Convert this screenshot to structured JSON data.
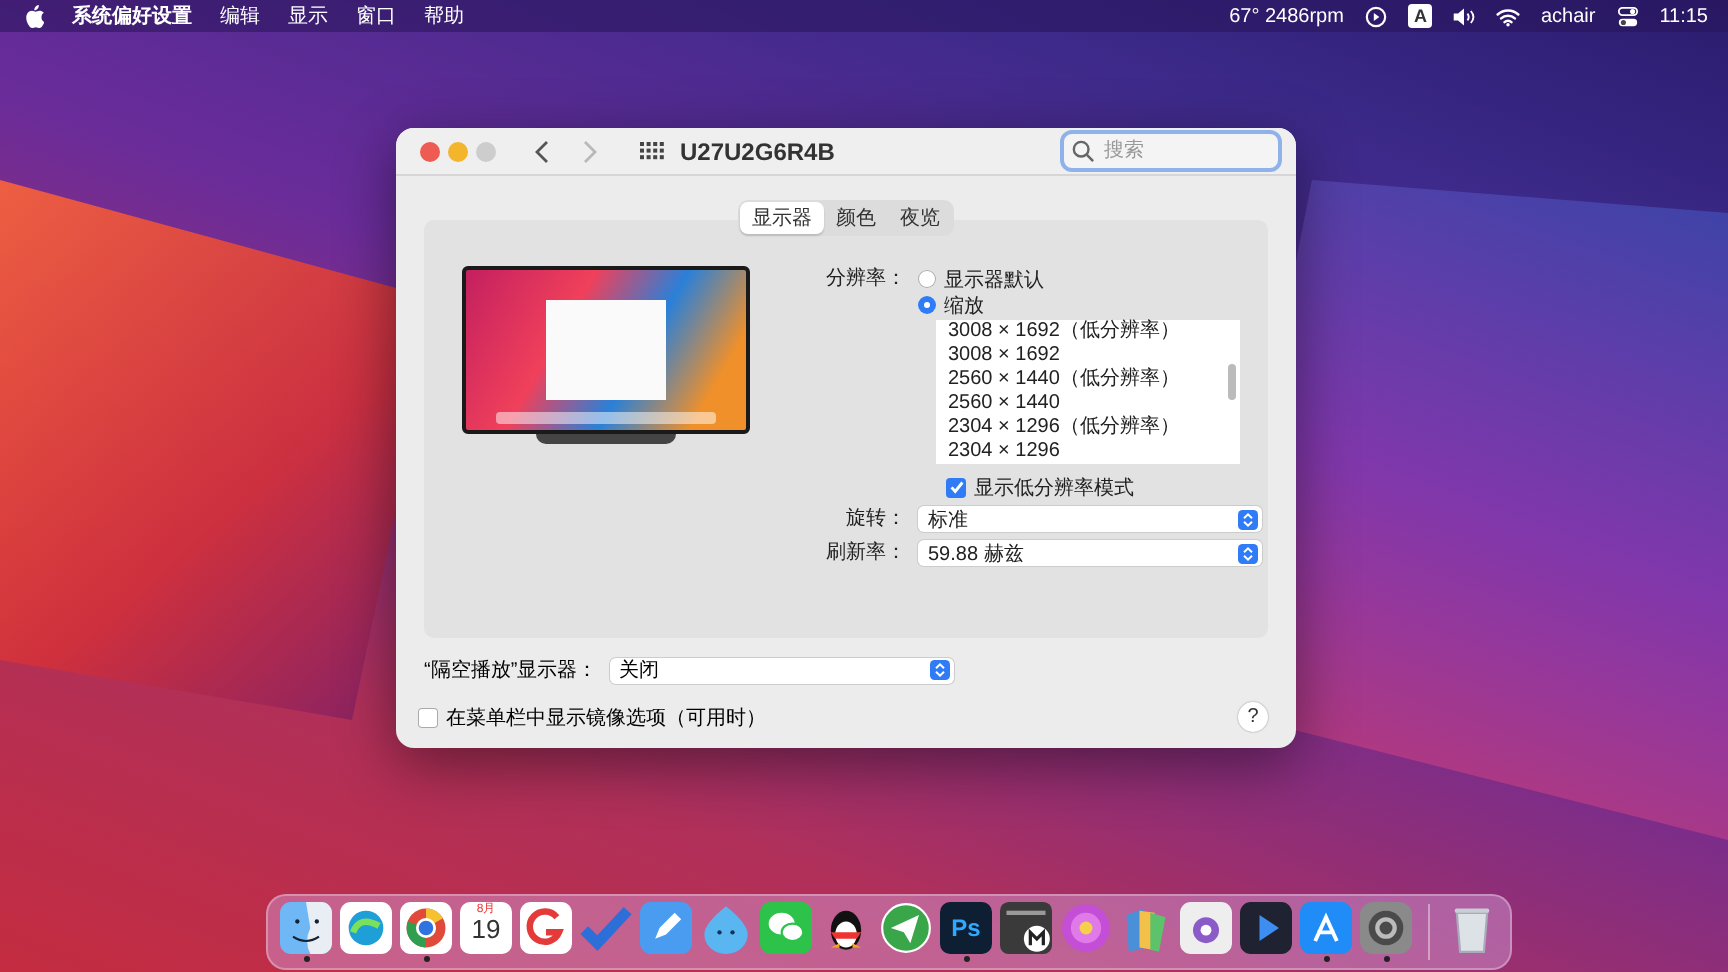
{
  "menu_bar": {
    "menus": [
      {
        "label": "系统偏好设置",
        "kind": "app"
      },
      {
        "label": "编辑",
        "kind": "menu"
      },
      {
        "label": "显示",
        "kind": "menu"
      },
      {
        "label": "窗口",
        "kind": "menu"
      },
      {
        "label": "帮助",
        "kind": "menu"
      }
    ],
    "sensor": "67° 2486rpm",
    "input_source": "A",
    "user": "achair",
    "clock": "11:15"
  },
  "window": {
    "title": "U27U2G6R4B",
    "nav": {
      "back_enabled": true,
      "forward_enabled": false
    },
    "search": {
      "placeholder": "搜索"
    },
    "tabs": [
      {
        "label": "显示器",
        "selected": true
      },
      {
        "label": "颜色",
        "selected": false
      },
      {
        "label": "夜览",
        "selected": false
      }
    ],
    "resolution": {
      "label": "分辨率：",
      "options": [
        {
          "label": "显示器默认",
          "selected": false
        },
        {
          "label": "缩放",
          "selected": true
        }
      ],
      "list": [
        "3008 × 1692（低分辨率）",
        "3008 × 1692",
        "2560 × 1440（低分辨率）",
        "2560 × 1440",
        "2304 × 1296（低分辨率）",
        "2304 × 1296"
      ],
      "low_res_checkbox": {
        "label": "显示低分辨率模式",
        "checked": true
      }
    },
    "rotation": {
      "label": "旋转：",
      "value": "标准"
    },
    "refresh": {
      "label": "刷新率：",
      "value": "59.88 赫兹"
    },
    "airplay": {
      "label": "“隔空播放”显示器：",
      "value": "关闭"
    },
    "mirror_checkbox": {
      "label": "在菜单栏中显示镜像选项（可用时）",
      "checked": false
    },
    "help": "?"
  },
  "dock": {
    "items": [
      {
        "kind": "finder",
        "running": true
      },
      {
        "kind": "swirl",
        "running": false
      },
      {
        "kind": "ring",
        "running": true
      },
      {
        "kind": "calendar",
        "month": "8月",
        "day": "19",
        "running": false
      },
      {
        "kind": "letter",
        "running": false
      },
      {
        "kind": "check",
        "running": false
      },
      {
        "kind": "pen",
        "running": false
      },
      {
        "kind": "drop",
        "running": false
      },
      {
        "kind": "chat",
        "running": false
      },
      {
        "kind": "penguin",
        "running": false
      },
      {
        "kind": "plane",
        "running": false
      },
      {
        "kind": "ps",
        "label": "Ps",
        "running": true
      },
      {
        "kind": "terminal",
        "running": false
      },
      {
        "kind": "flower",
        "running": false
      },
      {
        "kind": "folders",
        "running": false
      },
      {
        "kind": "camera",
        "running": false
      },
      {
        "kind": "play",
        "running": false
      },
      {
        "kind": "store",
        "running": true
      },
      {
        "kind": "gear",
        "running": true
      }
    ],
    "trash": {
      "running": false
    }
  }
}
